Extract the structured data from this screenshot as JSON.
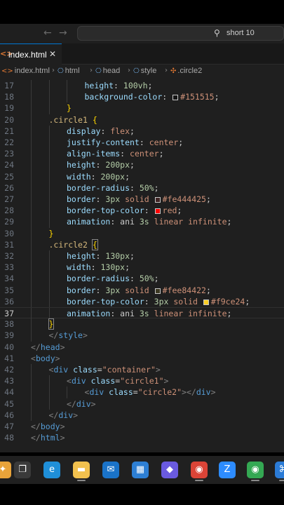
{
  "titlebar": {
    "back_arrow": "←",
    "forward_arrow": "→",
    "search_icon": "⚲",
    "search_text": "short 10"
  },
  "tab": {
    "icon": "<>",
    "label": "index.html",
    "close": "✕"
  },
  "breadcrumbs": [
    {
      "icon": "<>",
      "label": "index.html"
    },
    {
      "icon": "⎔",
      "label": "html"
    },
    {
      "icon": "⎔",
      "label": "head"
    },
    {
      "icon": "⎔",
      "label": "style"
    },
    {
      "icon": "✣",
      "label": ".circle2"
    }
  ],
  "breadcrumb_separator": "›",
  "editor": {
    "current_line": "37",
    "lines": [
      {
        "n": "17",
        "indent": 3,
        "tokens": [
          {
            "t": "height",
            "c": "t-prop"
          },
          {
            "t": ": ",
            "c": "t-pun"
          },
          {
            "t": "100vh",
            "c": "t-num"
          },
          {
            "t": ";",
            "c": "t-pun"
          }
        ]
      },
      {
        "n": "18",
        "indent": 3,
        "tokens": [
          {
            "t": "background-color",
            "c": "t-prop"
          },
          {
            "t": ": ",
            "c": "t-pun"
          },
          {
            "swatch": "#151515"
          },
          {
            "t": "#151515",
            "c": "t-val"
          },
          {
            "t": ";",
            "c": "t-pun"
          }
        ]
      },
      {
        "n": "19",
        "indent": 2,
        "tokens": [
          {
            "t": "}",
            "c": "t-brace"
          }
        ]
      },
      {
        "n": "20",
        "indent": 1,
        "tokens": [
          {
            "t": ".circle1",
            "c": "t-sel"
          },
          {
            "t": " ",
            "c": "t-pun"
          },
          {
            "t": "{",
            "c": "t-brace"
          }
        ]
      },
      {
        "n": "21",
        "indent": 2,
        "tokens": [
          {
            "t": "display",
            "c": "t-prop"
          },
          {
            "t": ": ",
            "c": "t-pun"
          },
          {
            "t": "flex",
            "c": "t-val"
          },
          {
            "t": ";",
            "c": "t-pun"
          }
        ]
      },
      {
        "n": "22",
        "indent": 2,
        "tokens": [
          {
            "t": "justify-content",
            "c": "t-prop"
          },
          {
            "t": ": ",
            "c": "t-pun"
          },
          {
            "t": "center",
            "c": "t-val"
          },
          {
            "t": ";",
            "c": "t-pun"
          }
        ]
      },
      {
        "n": "23",
        "indent": 2,
        "tokens": [
          {
            "t": "align-items",
            "c": "t-prop"
          },
          {
            "t": ": ",
            "c": "t-pun"
          },
          {
            "t": "center",
            "c": "t-val"
          },
          {
            "t": ";",
            "c": "t-pun"
          }
        ]
      },
      {
        "n": "24",
        "indent": 2,
        "tokens": [
          {
            "t": "height",
            "c": "t-prop"
          },
          {
            "t": ": ",
            "c": "t-pun"
          },
          {
            "t": "200px",
            "c": "t-num"
          },
          {
            "t": ";",
            "c": "t-pun"
          }
        ]
      },
      {
        "n": "25",
        "indent": 2,
        "tokens": [
          {
            "t": "width",
            "c": "t-prop"
          },
          {
            "t": ": ",
            "c": "t-pun"
          },
          {
            "t": "200px",
            "c": "t-num"
          },
          {
            "t": ";",
            "c": "t-pun"
          }
        ]
      },
      {
        "n": "26",
        "indent": 2,
        "tokens": [
          {
            "t": "border-radius",
            "c": "t-prop"
          },
          {
            "t": ": ",
            "c": "t-pun"
          },
          {
            "t": "50%",
            "c": "t-num"
          },
          {
            "t": ";",
            "c": "t-pun"
          }
        ]
      },
      {
        "n": "27",
        "indent": 2,
        "tokens": [
          {
            "t": "border",
            "c": "t-prop"
          },
          {
            "t": ": ",
            "c": "t-pun"
          },
          {
            "t": "3px",
            "c": "t-num"
          },
          {
            "t": " solid ",
            "c": "t-val"
          },
          {
            "swatch": "#fe444425"
          },
          {
            "t": "#fe444425",
            "c": "t-val"
          },
          {
            "t": ";",
            "c": "t-pun"
          }
        ]
      },
      {
        "n": "28",
        "indent": 2,
        "tokens": [
          {
            "t": "border-top-color",
            "c": "t-prop"
          },
          {
            "t": ": ",
            "c": "t-pun"
          },
          {
            "swatch": "#ff0000"
          },
          {
            "t": "red",
            "c": "t-val"
          },
          {
            "t": ";",
            "c": "t-pun"
          }
        ]
      },
      {
        "n": "29",
        "indent": 2,
        "tokens": [
          {
            "t": "animation",
            "c": "t-prop"
          },
          {
            "t": ": ",
            "c": "t-pun"
          },
          {
            "t": "ani ",
            "c": "t-pun"
          },
          {
            "t": "3s",
            "c": "t-num"
          },
          {
            "t": " linear infinite",
            "c": "t-val"
          },
          {
            "t": ";",
            "c": "t-pun"
          }
        ]
      },
      {
        "n": "30",
        "indent": 1,
        "tokens": [
          {
            "t": "}",
            "c": "t-brace"
          }
        ]
      },
      {
        "n": "31",
        "indent": 1,
        "tokens": [
          {
            "t": ".circle2",
            "c": "t-sel"
          },
          {
            "t": " ",
            "c": "t-pun"
          },
          {
            "t": "{",
            "c": "t-brace-hl"
          }
        ]
      },
      {
        "n": "32",
        "indent": 2,
        "tokens": [
          {
            "t": "height",
            "c": "t-prop"
          },
          {
            "t": ": ",
            "c": "t-pun"
          },
          {
            "t": "130px",
            "c": "t-num"
          },
          {
            "t": ";",
            "c": "t-pun"
          }
        ]
      },
      {
        "n": "33",
        "indent": 2,
        "tokens": [
          {
            "t": "width",
            "c": "t-prop"
          },
          {
            "t": ": ",
            "c": "t-pun"
          },
          {
            "t": "130px",
            "c": "t-num"
          },
          {
            "t": ";",
            "c": "t-pun"
          }
        ]
      },
      {
        "n": "34",
        "indent": 2,
        "tokens": [
          {
            "t": "border-radius",
            "c": "t-prop"
          },
          {
            "t": ": ",
            "c": "t-pun"
          },
          {
            "t": "50%",
            "c": "t-num"
          },
          {
            "t": ";",
            "c": "t-pun"
          }
        ]
      },
      {
        "n": "35",
        "indent": 2,
        "tokens": [
          {
            "t": "border",
            "c": "t-prop"
          },
          {
            "t": ": ",
            "c": "t-pun"
          },
          {
            "t": "3px",
            "c": "t-num"
          },
          {
            "t": " solid ",
            "c": "t-val"
          },
          {
            "swatch": "#fee84422"
          },
          {
            "t": "#fee84422",
            "c": "t-val"
          },
          {
            "t": ";",
            "c": "t-pun"
          }
        ]
      },
      {
        "n": "36",
        "indent": 2,
        "tokens": [
          {
            "t": "border-top-color",
            "c": "t-prop"
          },
          {
            "t": ": ",
            "c": "t-pun"
          },
          {
            "t": "3px",
            "c": "t-num"
          },
          {
            "t": " solid ",
            "c": "t-val"
          },
          {
            "swatch": "#f9ce24"
          },
          {
            "t": "#f9ce24",
            "c": "t-val"
          },
          {
            "t": ";",
            "c": "t-pun"
          }
        ]
      },
      {
        "n": "37",
        "indent": 2,
        "tokens": [
          {
            "t": "animation",
            "c": "t-prop"
          },
          {
            "t": ": ",
            "c": "t-pun"
          },
          {
            "t": "ani ",
            "c": "t-pun"
          },
          {
            "t": "3s",
            "c": "t-num"
          },
          {
            "t": " linear infinite",
            "c": "t-val"
          },
          {
            "t": ";",
            "c": "t-pun"
          }
        ]
      },
      {
        "n": "38",
        "indent": 1,
        "tokens": [
          {
            "t": "}",
            "c": "t-brace-hl"
          }
        ]
      },
      {
        "n": "39",
        "indent": 1,
        "tokens": [
          {
            "t": "</",
            "c": "t-ang"
          },
          {
            "t": "style",
            "c": "t-tag"
          },
          {
            "t": ">",
            "c": "t-ang"
          }
        ]
      },
      {
        "n": "40",
        "indent": 0,
        "tokens": [
          {
            "t": "</",
            "c": "t-ang"
          },
          {
            "t": "head",
            "c": "t-tag"
          },
          {
            "t": ">",
            "c": "t-ang"
          }
        ]
      },
      {
        "n": "41",
        "indent": 0,
        "tokens": [
          {
            "t": "<",
            "c": "t-ang"
          },
          {
            "t": "body",
            "c": "t-tag"
          },
          {
            "t": ">",
            "c": "t-ang"
          }
        ]
      },
      {
        "n": "42",
        "indent": 1,
        "tokens": [
          {
            "t": "<",
            "c": "t-ang"
          },
          {
            "t": "div",
            "c": "t-tag"
          },
          {
            "t": " ",
            "c": "t-pun"
          },
          {
            "t": "class",
            "c": "t-attr"
          },
          {
            "t": "=",
            "c": "t-pun"
          },
          {
            "t": "\"container\"",
            "c": "t-str"
          },
          {
            "t": ">",
            "c": "t-ang"
          }
        ]
      },
      {
        "n": "43",
        "indent": 2,
        "tokens": [
          {
            "t": "<",
            "c": "t-ang"
          },
          {
            "t": "div",
            "c": "t-tag"
          },
          {
            "t": " ",
            "c": "t-pun"
          },
          {
            "t": "class",
            "c": "t-attr"
          },
          {
            "t": "=",
            "c": "t-pun"
          },
          {
            "t": "\"circle1\"",
            "c": "t-str"
          },
          {
            "t": ">",
            "c": "t-ang"
          }
        ]
      },
      {
        "n": "44",
        "indent": 3,
        "tokens": [
          {
            "t": "<",
            "c": "t-ang"
          },
          {
            "t": "div",
            "c": "t-tag"
          },
          {
            "t": " ",
            "c": "t-pun"
          },
          {
            "t": "class",
            "c": "t-attr"
          },
          {
            "t": "=",
            "c": "t-pun"
          },
          {
            "t": "\"circle2\"",
            "c": "t-str"
          },
          {
            "t": "></",
            "c": "t-ang"
          },
          {
            "t": "div",
            "c": "t-tag"
          },
          {
            "t": ">",
            "c": "t-ang"
          }
        ]
      },
      {
        "n": "45",
        "indent": 2,
        "tokens": [
          {
            "t": "</",
            "c": "t-ang"
          },
          {
            "t": "div",
            "c": "t-tag"
          },
          {
            "t": ">",
            "c": "t-ang"
          }
        ]
      },
      {
        "n": "46",
        "indent": 1,
        "tokens": [
          {
            "t": "</",
            "c": "t-ang"
          },
          {
            "t": "div",
            "c": "t-tag"
          },
          {
            "t": ">",
            "c": "t-ang"
          }
        ]
      },
      {
        "n": "47",
        "indent": 0,
        "tokens": [
          {
            "t": "</",
            "c": "t-ang"
          },
          {
            "t": "body",
            "c": "t-tag"
          },
          {
            "t": ">",
            "c": "t-ang"
          }
        ]
      },
      {
        "n": "48",
        "indent": 0,
        "tokens": [
          {
            "t": "</",
            "c": "t-ang"
          },
          {
            "t": "html",
            "c": "t-tag"
          },
          {
            "t": ">",
            "c": "t-ang"
          }
        ]
      }
    ]
  },
  "taskbar": {
    "items": [
      {
        "name": "widgets-icon",
        "glyph": "✦",
        "color": "#e8a33a"
      },
      {
        "name": "task-view-icon",
        "glyph": "❐",
        "color": "#3a3a3a"
      },
      {
        "name": "edge-icon",
        "glyph": "e",
        "color": "#1f8fd8"
      },
      {
        "name": "file-explorer-icon",
        "glyph": "▬",
        "color": "#f2c14e"
      },
      {
        "name": "mail-icon",
        "glyph": "✉",
        "color": "#1a73c8"
      },
      {
        "name": "store-icon",
        "glyph": "▦",
        "color": "#2d7fd4"
      },
      {
        "name": "copilot-icon",
        "glyph": "◆",
        "color": "#6a5ae0"
      },
      {
        "name": "chrome-icon",
        "glyph": "◉",
        "color": "#db4437"
      },
      {
        "name": "zoom-icon",
        "glyph": "Z",
        "color": "#2d8cff"
      },
      {
        "name": "chrome-profile-icon",
        "glyph": "◉",
        "color": "#34a853"
      },
      {
        "name": "vscode-icon",
        "glyph": "⌘",
        "color": "#2b7bd6"
      }
    ]
  }
}
